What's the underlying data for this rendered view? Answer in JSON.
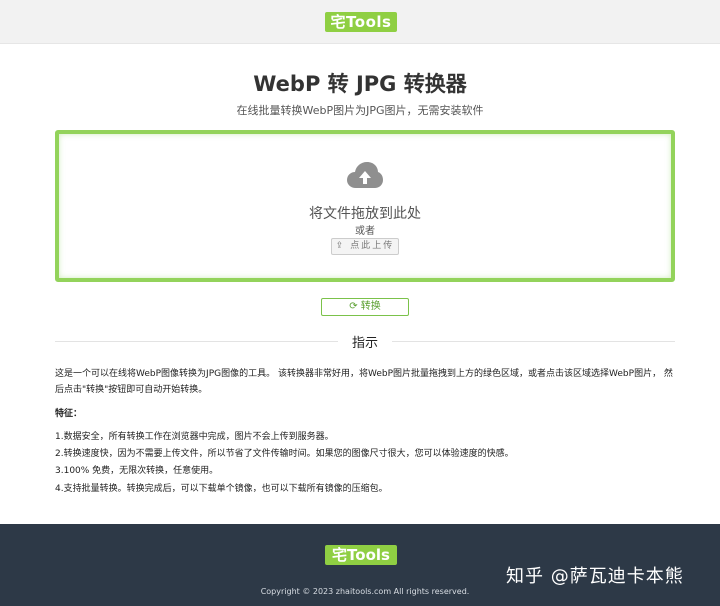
{
  "header": {
    "logo_text": "宅Tools"
  },
  "main": {
    "title": "WebP 转 JPG 转换器",
    "subtitle": "在线批量转换WebP图片为JPG图片，无需安装软件",
    "dropzone": {
      "drop_text": "将文件拖放到此处",
      "or_text": "或者",
      "upload_label": "⇪ 点此上传"
    },
    "convert_label": "⟳ 转换",
    "colors": {
      "accent": "#93d35b",
      "brand": "#8fcf43",
      "footer_bg": "#2d3947"
    }
  },
  "instructions": {
    "title": "指示",
    "intro": "这是一个可以在线将WebP图像转换为JPG图像的工具。 该转换器非常好用，将WebP图片批量拖拽到上方的绿色区域，或者点击该区域选择WebP图片， 然后点击\"转换\"按钮即可自动开始转换。",
    "features_heading": "特征：",
    "features": [
      "1.数据安全，所有转换工作在浏览器中完成，图片不会上传到服务器。",
      "2.转换速度快，因为不需要上传文件，所以节省了文件传输时间。如果您的图像尺寸很大，您可以体验速度的快感。",
      "3.100% 免费，无限次转换，任意使用。",
      "4.支持批量转换。转换完成后，可以下载单个镜像，也可以下载所有镜像的压缩包。"
    ]
  },
  "footer": {
    "logo_text": "宅Tools",
    "copyright": "Copyright © 2023 zhaitools.com All rights reserved.",
    "watermark": "知乎 @萨瓦迪卡本熊"
  }
}
